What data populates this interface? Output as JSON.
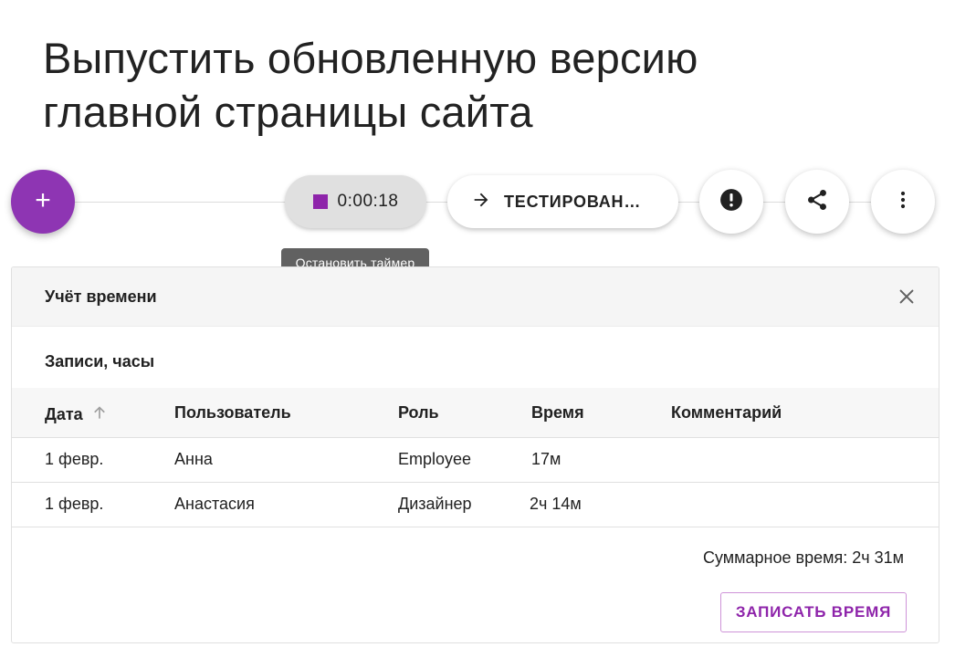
{
  "task": {
    "title": "Выпустить обновленную версию главной страницы сайта"
  },
  "toolbar": {
    "add_icon": "plus-icon",
    "timer_value": "0:00:18",
    "timer_icon": "stop-square-icon",
    "timer_tooltip": "Остановить таймер",
    "status_label": "ТЕСТИРОВАН…",
    "status_icon": "arrow-right-icon",
    "alert_icon": "exclamation-circle-icon",
    "share_icon": "share-icon",
    "more_icon": "more-vertical-icon"
  },
  "panel": {
    "title": "Учёт времени",
    "close_icon": "close-icon",
    "section_title": "Записи, часы",
    "columns": {
      "date": "Дата",
      "user": "Пользователь",
      "role": "Роль",
      "time": "Время",
      "comment": "Комментарий"
    },
    "sort_icon": "arrow-up-icon",
    "rows": [
      {
        "date": "1 февр.",
        "user": "Анна",
        "role": "Employee",
        "time": "17м",
        "comment": ""
      },
      {
        "date": "1 февр.",
        "user": "Анастасия",
        "role": "Дизайнер",
        "time": "2ч 14м",
        "comment": ""
      }
    ],
    "total": "Суммарное время: 2ч 31м",
    "log_button": "ЗАПИСАТЬ ВРЕМЯ"
  },
  "colors": {
    "accent": "#8e24aa",
    "fab": "#8e35b3",
    "tooltip_bg": "#616161"
  }
}
